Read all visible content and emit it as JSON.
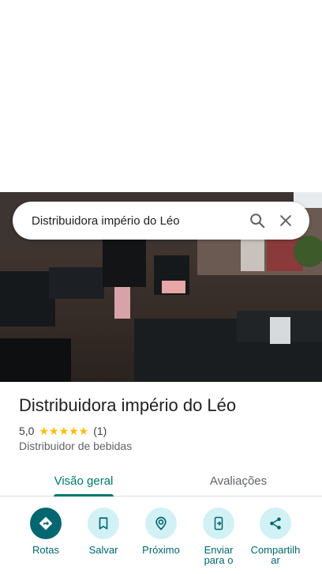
{
  "search": {
    "query": "Distribuidora império do Léo"
  },
  "place": {
    "name": "Distribuidora império do Léo",
    "rating": "5,0",
    "stars": "★★★★★",
    "review_count": "(1)",
    "category": "Distribuidor de bebidas"
  },
  "tabs": [
    {
      "label": "Visão geral",
      "active": true
    },
    {
      "label": "Avaliações",
      "active": false
    }
  ],
  "actions": [
    {
      "label": "Rotas",
      "icon": "directions-icon"
    },
    {
      "label": "Salvar",
      "icon": "bookmark-icon"
    },
    {
      "label": "Próximo",
      "icon": "nearby-icon"
    },
    {
      "label": "Enviar para o",
      "icon": "send-to-phone-icon"
    },
    {
      "label": "Compartilhar",
      "icon": "share-icon"
    }
  ],
  "colors": {
    "accent": "#00796b",
    "action_primary": "#00666f",
    "action_bg": "#d2f1f5",
    "star": "#fbbc04"
  }
}
